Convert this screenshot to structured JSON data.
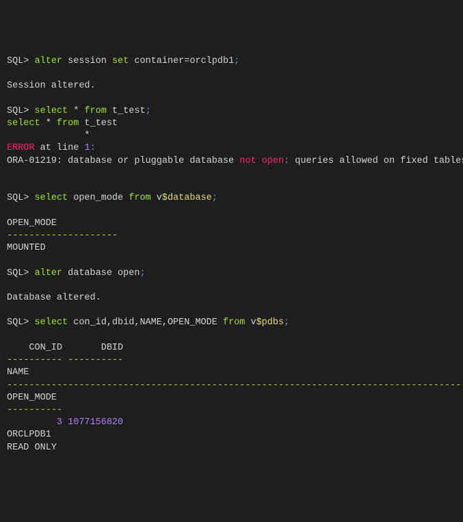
{
  "prompt": "SQL> ",
  "cmd1": {
    "alter": "alter",
    "session": " session ",
    "set": "set",
    "rest": " container=orclpdb1",
    "semi": ";"
  },
  "session_altered": "Session altered.",
  "cmd2": {
    "select": "select",
    "rest": " * ",
    "from": "from",
    "tbl": " t_test",
    "semi": ";"
  },
  "echo2": {
    "select": "select",
    "rest": " * ",
    "from": "from",
    "tbl": " t_test"
  },
  "star_line": "              *",
  "error_word": "ERROR",
  "error_rest1": " at line ",
  "error_line_num": "1",
  "error_colon": ":",
  "ora_pre": "ORA-01219: database or pluggable database ",
  "ora_notopen": "not open",
  "ora_colon": ":",
  "ora_post": " queries allowed on fixed tables or views only",
  "cmd3": {
    "select": "select",
    "s1": " open_mode ",
    "from": "from",
    "s2": " v",
    "dol": "$database",
    "semi": ";"
  },
  "open_mode_hdr": "OPEN_MODE",
  "open_mode_dash": "--------------------",
  "open_mode_val": "MOUNTED",
  "cmd4": {
    "alter": "alter",
    "rest": " database open",
    "semi": ";"
  },
  "db_altered": "Database altered.",
  "cmd5": {
    "select": "select",
    "cols": " con_id,dbid,NAME,OPEN_MODE ",
    "from": "from",
    "s2": " v",
    "dol": "$pdbs",
    "semi": ";"
  },
  "hdr_conid": "    CON_ID       DBID",
  "dash_conid": "---------- ----------",
  "hdr_name": "NAME",
  "dash_long": "--------------------------------------------------------------------------------------",
  "hdr_open": "OPEN_MODE",
  "dash_open": "----------",
  "row_nums": "         3 1077156820",
  "row_name": "ORCLPDB1",
  "row_open": "READ ONLY"
}
